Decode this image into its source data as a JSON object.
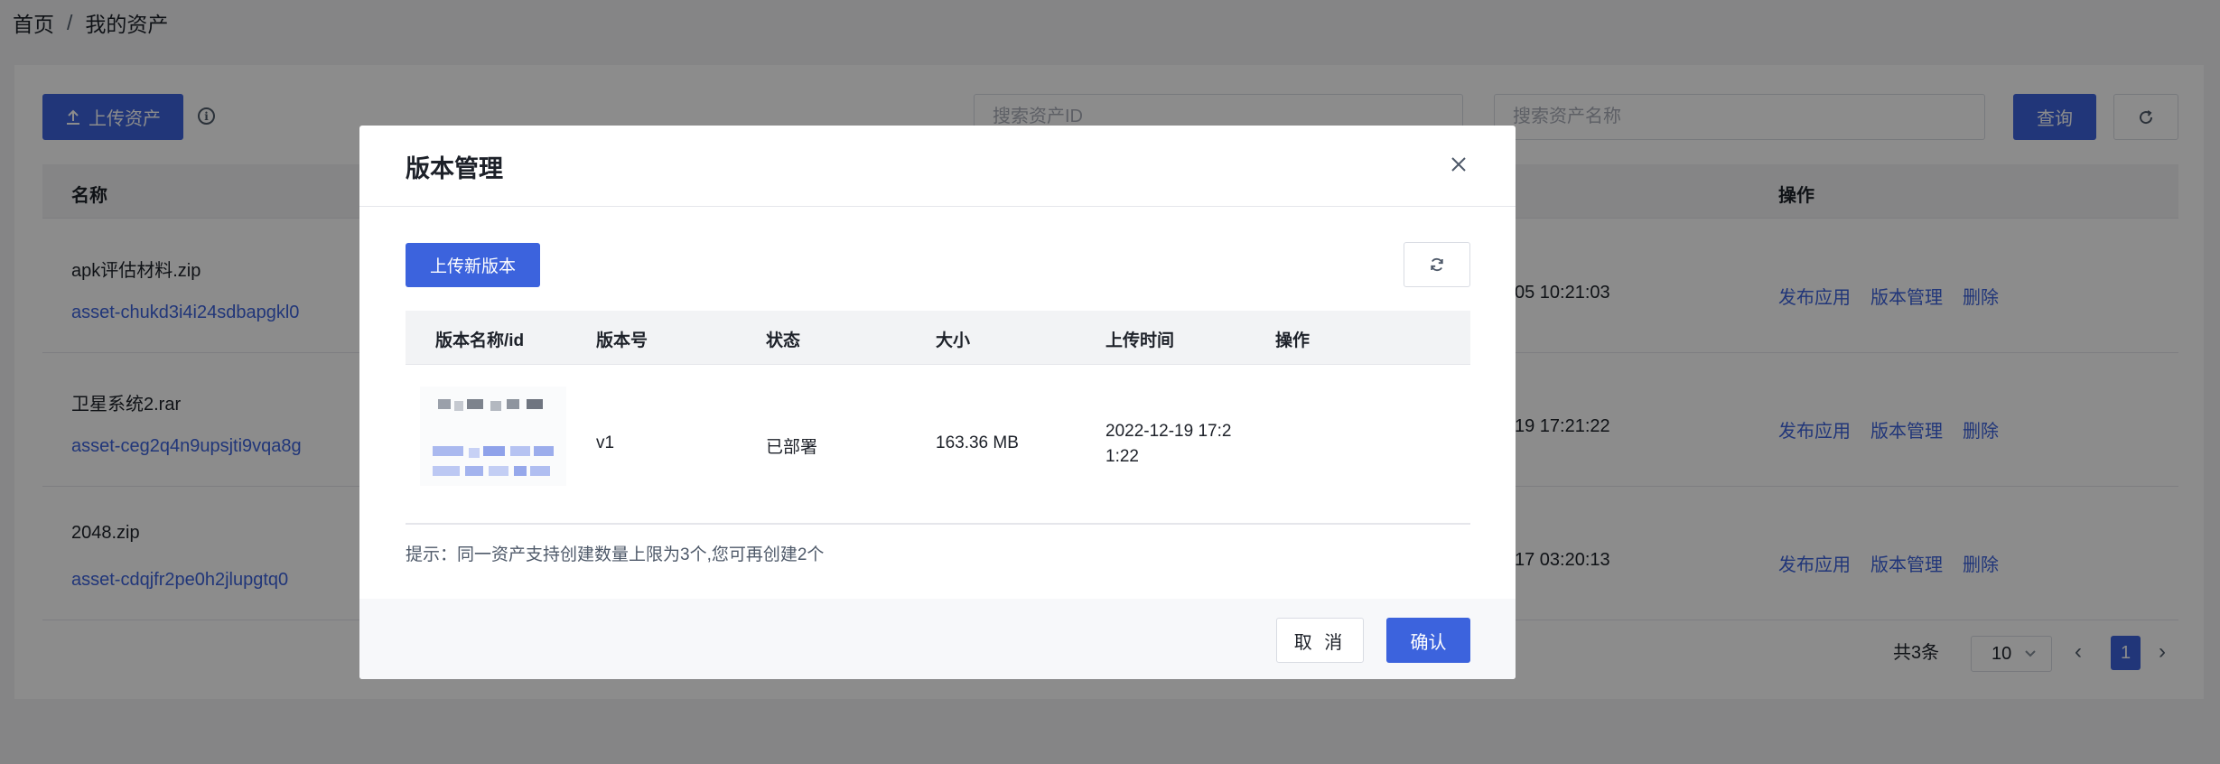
{
  "breadcrumb": {
    "home": "首页",
    "separator": "/",
    "current": "我的资产"
  },
  "toolbar": {
    "upload_label": "上传资产",
    "search_id_placeholder": "搜索资产ID",
    "search_name_placeholder": "搜索资产名称",
    "query_label": "查询"
  },
  "table": {
    "columns": {
      "name": "名称",
      "actions": "操作"
    },
    "rows": [
      {
        "name": "apk评估材料.zip",
        "asset_id": "asset-chukd3i4i24sdbapgkl0",
        "time": "05 10:21:03"
      },
      {
        "name": "卫星系统2.rar",
        "asset_id": "asset-ceg2q4n9upsjti9vqa8g",
        "time": "19 17:21:22"
      },
      {
        "name": "2048.zip",
        "asset_id": "asset-cdqjfr2pe0h2jlupgtq0",
        "time": "17 03:20:13"
      }
    ],
    "actions": {
      "publish": "发布应用",
      "version_manage": "版本管理",
      "delete": "删除"
    }
  },
  "pagination": {
    "total": "共3条",
    "page_size": "10",
    "current_page": "1"
  },
  "modal": {
    "title": "版本管理",
    "upload_new_version": "上传新版本",
    "columns": {
      "name_id": "版本名称/id",
      "version": "版本号",
      "status": "状态",
      "size": "大小",
      "upload_time": "上传时间",
      "actions": "操作"
    },
    "row": {
      "version": "v1",
      "status": "已部署",
      "size": "163.36 MB",
      "upload_time": "2022-12-19 17:21:22"
    },
    "tip": "提示：同一资产支持创建数量上限为3个,您可再创建2个",
    "cancel": "取 消",
    "confirm": "确认"
  },
  "colors": {
    "primary": "#3c63dd",
    "mask": "rgba(0,0,0,0.45)"
  },
  "icons": [
    "upload-icon",
    "info-icon",
    "refresh-icon",
    "close-icon",
    "chevron-down-icon",
    "chevron-left-icon",
    "chevron-right-icon"
  ]
}
